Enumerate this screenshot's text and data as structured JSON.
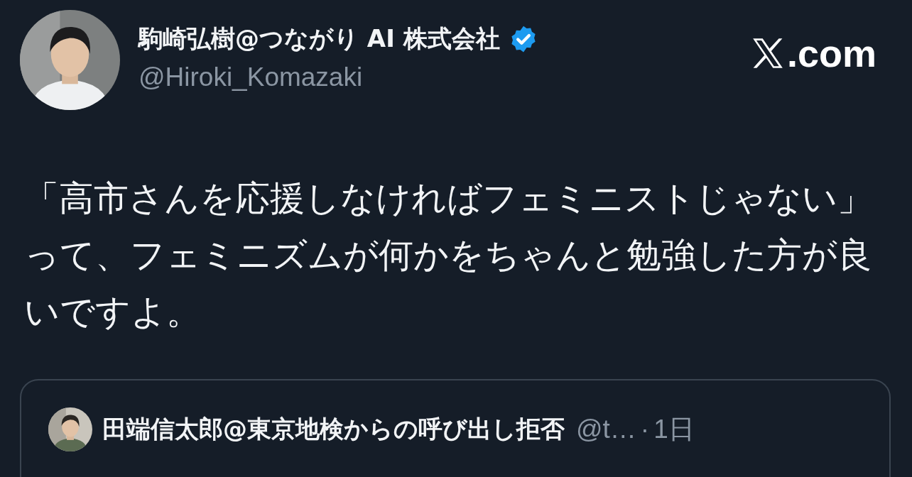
{
  "post": {
    "author": {
      "name": "駒崎弘樹@つながり AI 株式会社",
      "verified": true,
      "handle": "@Hiroki_Komazaki"
    },
    "site": ".com",
    "text": "「高市さんを応援しなければフェミニストじゃない」って、フェミニズムが何かをちゃんと勉強した方が良いですよ。",
    "quote": {
      "author": {
        "name": "田端信太郎@東京地検からの呼び出し拒否",
        "handle": "@t…",
        "separator": "·",
        "time": "1日"
      }
    }
  }
}
